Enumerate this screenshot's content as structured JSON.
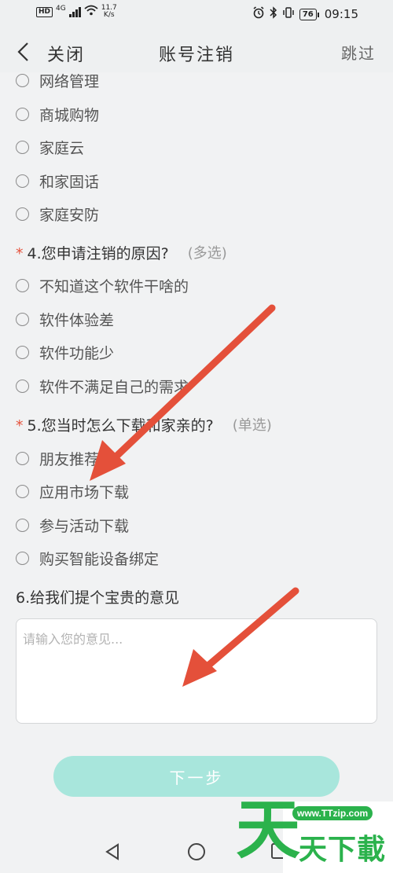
{
  "status_bar": {
    "hd": "HD",
    "network": "4G",
    "speed_value": "11.7",
    "speed_unit": "K/s",
    "battery": "76",
    "time": "09:15"
  },
  "nav": {
    "close_label": "关闭",
    "title": "账号注销",
    "skip_label": "跳过"
  },
  "q3_options": [
    "网络管理",
    "商城购物",
    "家庭云",
    "和家固话",
    "家庭安防"
  ],
  "q4": {
    "required_mark": "*",
    "text": "4.您申请注销的原因?",
    "tag": "(多选)",
    "options": [
      "不知道这个软件干啥的",
      "软件体验差",
      "软件功能少",
      "软件不满足自己的需求"
    ]
  },
  "q5": {
    "required_mark": "*",
    "text": "5.您当时怎么下载和家亲的?",
    "tag": "(单选)",
    "options": [
      "朋友推荐",
      "应用市场下载",
      "参与活动下载",
      "购买智能设备绑定"
    ]
  },
  "q6": {
    "text": "6.给我们提个宝贵的意见",
    "placeholder": "请输入您的意见..."
  },
  "next_button_label": "下一步",
  "watermark": {
    "char": "天",
    "url": "www.TTzip.com",
    "text": "天下載"
  },
  "colors": {
    "accent_button": "#a8e6dc",
    "required": "#e5533d",
    "arrow": "#e4503a",
    "watermark": "#2bb24c"
  }
}
